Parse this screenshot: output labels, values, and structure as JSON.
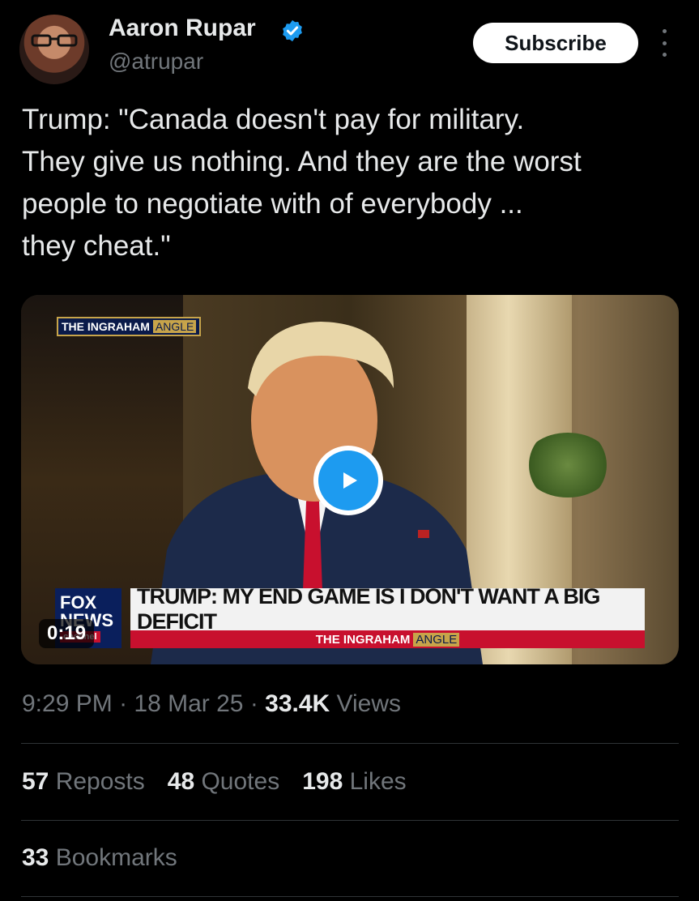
{
  "author": {
    "name": "Aaron Rupar",
    "handle": "@atrupar",
    "verified_icon": "verified-badge-icon",
    "avatar_icon": "avatar"
  },
  "header": {
    "subscribe_label": "Subscribe",
    "more_icon": "more-vertical-icon"
  },
  "tweet": {
    "text": "Trump: \"Canada doesn't pay for military.\nThey give us nothing. And they are the worst\npeople to negotiate with of everybody ...\nthey cheat.\""
  },
  "video": {
    "show_logo_the": "THE INGRAHAM",
    "show_logo_angle": "ANGLE",
    "chyron_headline": "TRUMP: MY END GAME IS I DON'T WANT A BIG DEFICIT",
    "chyron_sub_the": "THE INGRAHAM",
    "chyron_sub_angle": "ANGLE",
    "network_fox": "FOX",
    "network_news": "NEWS",
    "network_channel": "channel",
    "duration": "0:19",
    "play_icon": "play-icon"
  },
  "meta": {
    "time": "9:29 PM",
    "sep1": " · ",
    "date": "18 Mar 25",
    "sep2": " · ",
    "views_count": "33.4K",
    "views_label": " Views"
  },
  "stats": {
    "reposts_count": "57",
    "reposts_label": " Reposts",
    "quotes_count": "48",
    "quotes_label": " Quotes",
    "likes_count": "198",
    "likes_label": " Likes",
    "bookmarks_count": "33",
    "bookmarks_label": " Bookmarks"
  },
  "colors": {
    "background": "#000000",
    "text_primary": "#e7e9ea",
    "text_secondary": "#71767b",
    "accent_blue": "#1d9bf0",
    "divider": "#2f3336"
  }
}
